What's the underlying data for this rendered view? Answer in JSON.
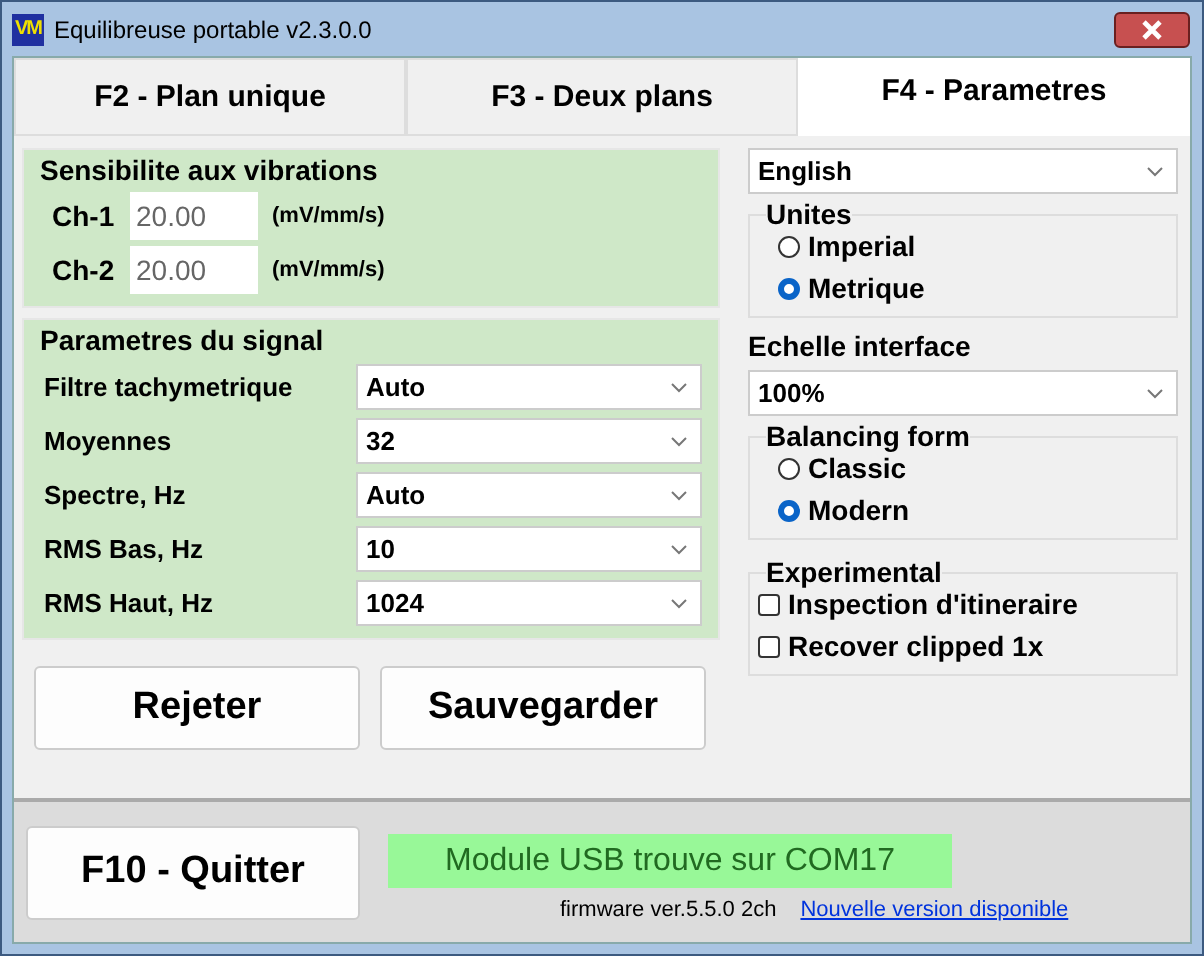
{
  "window": {
    "title": "Equilibreuse portable v2.3.0.0",
    "logo": "VM"
  },
  "tabs": [
    {
      "label": "F2 - Plan unique",
      "selected": false
    },
    {
      "label": "F3 - Deux plans",
      "selected": false
    },
    {
      "label": "F4 - Parametres",
      "selected": true
    }
  ],
  "sensitivity": {
    "title": "Sensibilite aux vibrations",
    "channels": [
      {
        "label": "Ch-1",
        "value": "20.00",
        "unit": "(mV/mm/s)"
      },
      {
        "label": "Ch-2",
        "value": "20.00",
        "unit": "(mV/mm/s)"
      }
    ]
  },
  "signal": {
    "title": "Parametres du signal",
    "rows": [
      {
        "label": "Filtre tachymetrique",
        "value": "Auto"
      },
      {
        "label": "Moyennes",
        "value": "32"
      },
      {
        "label": "Spectre, Hz",
        "value": "Auto"
      },
      {
        "label": "RMS Bas, Hz",
        "value": "10"
      },
      {
        "label": "RMS Haut, Hz",
        "value": "1024"
      }
    ]
  },
  "actions": [
    "Rejeter",
    "Sauvegarder"
  ],
  "language": "English",
  "units": {
    "title": "Unites",
    "options": [
      {
        "label": "Imperial",
        "selected": false
      },
      {
        "label": "Metrique",
        "selected": true
      }
    ]
  },
  "scale": {
    "label": "Echelle interface",
    "value": "100%"
  },
  "balancing_form": {
    "title": "Balancing form",
    "options": [
      {
        "label": "Classic",
        "selected": false
      },
      {
        "label": "Modern",
        "selected": true
      }
    ]
  },
  "experimental": {
    "title": "Experimental",
    "options": [
      {
        "label": "Inspection d'itineraire",
        "checked": false
      },
      {
        "label": "Recover clipped 1x",
        "checked": false
      }
    ]
  },
  "footer": {
    "quit": "F10 - Quitter",
    "status": "Module USB trouve sur COM17",
    "firmware": "firmware ver.5.5.0 2ch",
    "update_link": "Nouvelle version disponible"
  }
}
